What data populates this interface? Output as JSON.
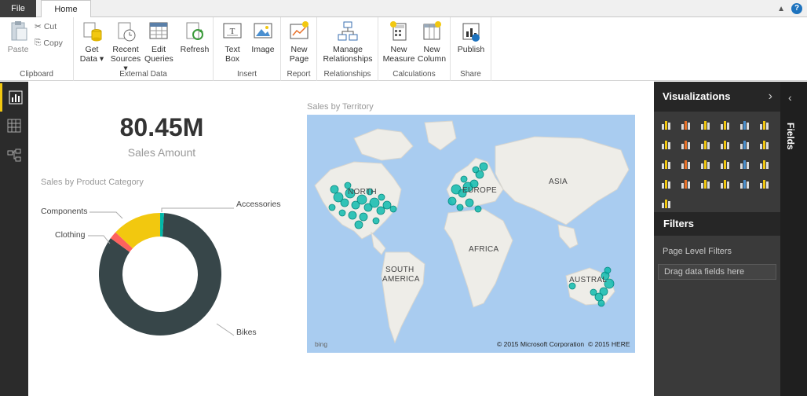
{
  "tabs": {
    "file": "File",
    "home": "Home"
  },
  "ribbon": {
    "clipboard": {
      "label": "Clipboard",
      "paste": "Paste",
      "cut": "Cut",
      "copy": "Copy"
    },
    "external_data": {
      "label": "External Data",
      "get_data_1": "Get",
      "get_data_2": "Data",
      "recent_1": "Recent",
      "recent_2": "Sources",
      "edit_1": "Edit",
      "edit_2": "Queries",
      "refresh": "Refresh"
    },
    "insert": {
      "label": "Insert",
      "textbox_1": "Text",
      "textbox_2": "Box",
      "image": "Image"
    },
    "report": {
      "label": "Report",
      "newpage_1": "New",
      "newpage_2": "Page"
    },
    "relationships": {
      "label": "Relationships",
      "manage_1": "Manage",
      "manage_2": "Relationships"
    },
    "calculations": {
      "label": "Calculations",
      "measure_1": "New",
      "measure_2": "Measure",
      "column_1": "New",
      "column_2": "Column"
    },
    "share": {
      "label": "Share",
      "publish": "Publish"
    }
  },
  "card": {
    "value": "80.45M",
    "label": "Sales Amount"
  },
  "donut": {
    "title": "Sales by Product Category",
    "labels": {
      "components": "Components",
      "clothing": "Clothing",
      "accessories": "Accessories",
      "bikes": "Bikes"
    }
  },
  "chart_data": {
    "type": "pie",
    "title": "Sales by Product Category",
    "categories": [
      "Bikes",
      "Clothing",
      "Components",
      "Accessories"
    ],
    "values": [
      84,
      2,
      13,
      1
    ],
    "colors": [
      "#374649",
      "#fd625e",
      "#f2c80f",
      "#01b8aa"
    ]
  },
  "map": {
    "title": "Sales by Territory",
    "labels": {
      "north_america_1": "NORTH",
      "europe": "EUROPE",
      "asia": "ASIA",
      "africa": "AFRICA",
      "south_america_1": "SOUTH",
      "south_america_2": "AMERICA",
      "australia": "AUSTRAL"
    },
    "bing": "bing",
    "copyright_ms": "© 2015 Microsoft Corporation",
    "copyright_here": "© 2015 HERE",
    "bubble_color": "#01b8aa"
  },
  "visualizations": {
    "title": "Visualizations"
  },
  "filters": {
    "title": "Filters",
    "page_level": "Page Level Filters",
    "drop_hint": "Drag data fields here"
  },
  "fields": {
    "title": "Fields"
  },
  "colors": {
    "accent": "#f2c811",
    "dark_pane": "#262626",
    "teal": "#01b8aa"
  }
}
